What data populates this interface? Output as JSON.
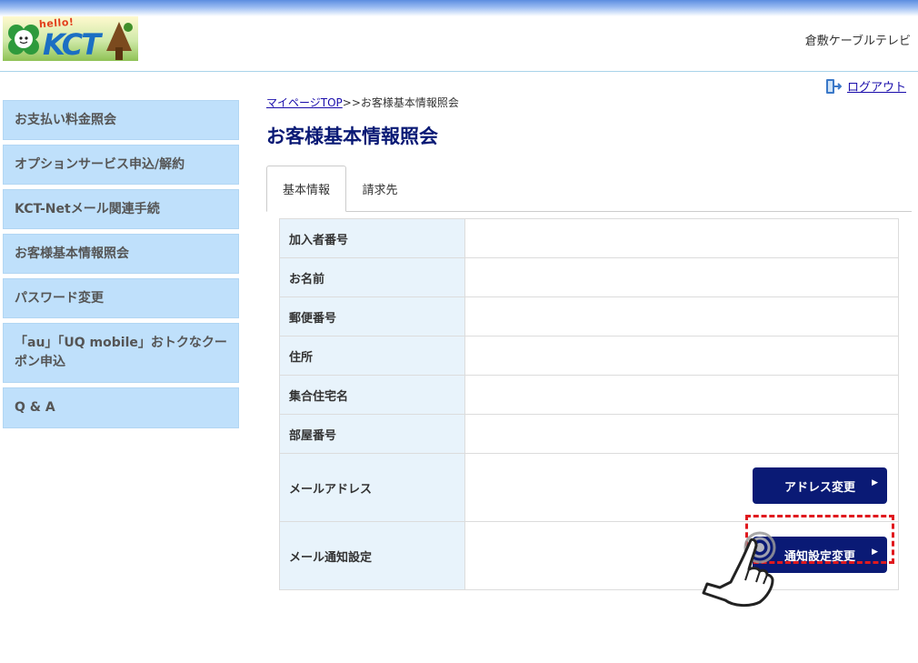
{
  "header": {
    "logo_greeting": "hello!",
    "logo_text": "KCT",
    "company": "倉敷ケーブルテレビ"
  },
  "logout": {
    "label": "ログアウト"
  },
  "sidebar": {
    "items": [
      {
        "label": "お支払い料金照会"
      },
      {
        "label": "オプションサービス申込/解約"
      },
      {
        "label": "KCT-Netメール関連手続"
      },
      {
        "label": "お客様基本情報照会"
      },
      {
        "label": "パスワード変更"
      },
      {
        "label": "「au」「UQ mobile」おトクなクーポン申込"
      },
      {
        "label": "Q & A"
      }
    ]
  },
  "breadcrumb": {
    "link": "マイページTOP",
    "separator": ">>",
    "current": "お客様基本情報照会"
  },
  "page_title": "お客様基本情報照会",
  "tabs": [
    {
      "label": "基本情報",
      "active": true
    },
    {
      "label": "請求先",
      "active": false
    }
  ],
  "table": {
    "rows": [
      {
        "label": "加入者番号",
        "value": ""
      },
      {
        "label": "お名前",
        "value": ""
      },
      {
        "label": "郵便番号",
        "value": ""
      },
      {
        "label": "住所",
        "value": ""
      },
      {
        "label": "集合住宅名",
        "value": ""
      },
      {
        "label": "部屋番号",
        "value": ""
      },
      {
        "label": "メールアドレス",
        "value": "",
        "button": "アドレス変更"
      },
      {
        "label": "メール通知設定",
        "value": "",
        "button": "通知設定変更"
      }
    ]
  },
  "colors": {
    "accent_dark": "#0a1a75",
    "sidebar_bg": "#bfe0fb",
    "label_bg": "#e8f3fb",
    "highlight": "#e0191e"
  }
}
